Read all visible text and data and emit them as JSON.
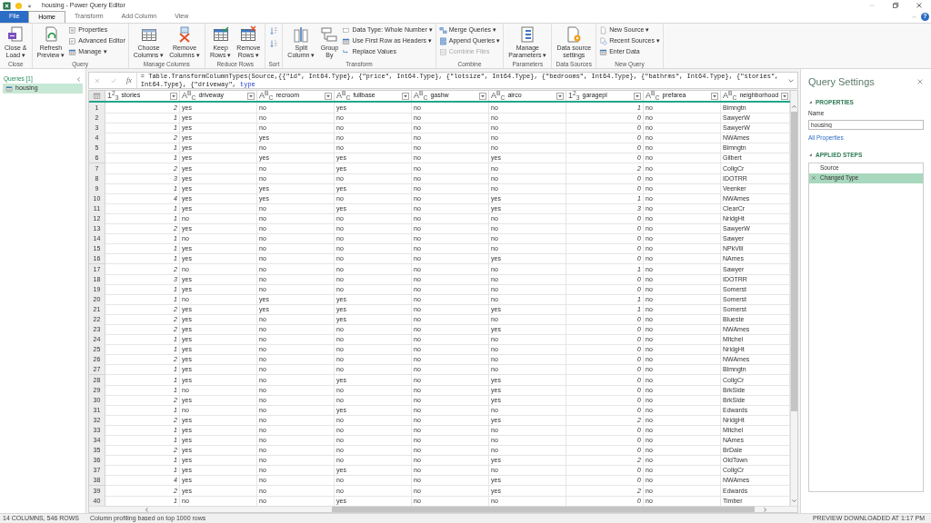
{
  "window": {
    "title": "housing - Power Query Editor",
    "help_label": "?"
  },
  "ribbon_tabs": [
    {
      "label": "File",
      "kind": "file",
      "selected": false
    },
    {
      "label": "Home",
      "kind": "tab",
      "selected": true
    },
    {
      "label": "Transform",
      "kind": "tab",
      "selected": false
    },
    {
      "label": "Add Column",
      "kind": "tab",
      "selected": false
    },
    {
      "label": "View",
      "kind": "tab",
      "selected": false
    }
  ],
  "ribbon_groups": [
    {
      "label": "Close",
      "items": [
        {
          "kind": "large",
          "lines": [
            "Close &",
            "Load ▾"
          ],
          "disabled": false
        }
      ]
    },
    {
      "label": "Query",
      "items": [
        {
          "kind": "large",
          "lines": [
            "Refresh",
            "Preview ▾"
          ],
          "disabled": false
        },
        {
          "kind": "stack",
          "buttons": [
            {
              "label": "Properties",
              "disabled": false
            },
            {
              "label": "Advanced Editor",
              "disabled": false
            },
            {
              "label": "Manage ▾",
              "disabled": false
            }
          ]
        }
      ]
    },
    {
      "label": "Manage Columns",
      "items": [
        {
          "kind": "large",
          "lines": [
            "Choose",
            "Columns ▾"
          ],
          "disabled": false
        },
        {
          "kind": "large",
          "lines": [
            "Remove",
            "Columns ▾"
          ],
          "disabled": false
        }
      ]
    },
    {
      "label": "Reduce Rows",
      "items": [
        {
          "kind": "large",
          "lines": [
            "Keep",
            "Rows ▾"
          ],
          "disabled": false
        },
        {
          "kind": "large",
          "lines": [
            "Remove",
            "Rows ▾"
          ],
          "disabled": false
        }
      ]
    },
    {
      "label": "Sort",
      "items": [
        {
          "kind": "icon_stack",
          "buttons": [
            {
              "disabled": false
            },
            {
              "disabled": false
            }
          ]
        }
      ]
    },
    {
      "label": "Transform",
      "items": [
        {
          "kind": "large",
          "lines": [
            "Split",
            "Column ▾"
          ],
          "disabled": false
        },
        {
          "kind": "large",
          "lines": [
            "Group",
            "By"
          ],
          "disabled": false
        },
        {
          "kind": "stack",
          "buttons": [
            {
              "label": "Data Type: Whole Number ▾",
              "disabled": false
            },
            {
              "label": "Use First Row as Headers ▾",
              "disabled": false
            },
            {
              "label": "Replace Values",
              "disabled": false
            }
          ]
        }
      ]
    },
    {
      "label": "Combine",
      "items": [
        {
          "kind": "stack",
          "buttons": [
            {
              "label": "Merge Queries ▾",
              "disabled": false
            },
            {
              "label": "Append Queries ▾",
              "disabled": false
            },
            {
              "label": "Combine Files",
              "disabled": true
            }
          ]
        }
      ]
    },
    {
      "label": "Parameters",
      "items": [
        {
          "kind": "large",
          "lines": [
            "Manage",
            "Parameters ▾"
          ],
          "disabled": false
        }
      ]
    },
    {
      "label": "Data Sources",
      "items": [
        {
          "kind": "large",
          "lines": [
            "Data source",
            "settings"
          ],
          "disabled": false
        }
      ]
    },
    {
      "label": "New Query",
      "items": [
        {
          "kind": "stack",
          "buttons": [
            {
              "label": "New Source ▾",
              "disabled": false
            },
            {
              "label": "Recent Sources ▾",
              "disabled": false
            },
            {
              "label": "Enter Data",
              "disabled": false
            }
          ]
        }
      ]
    }
  ],
  "queries_pane": {
    "header": "Queries [1]",
    "items": [
      {
        "label": "housing",
        "selected": true
      }
    ]
  },
  "formula_bar": {
    "fx_label": "fx",
    "parts": [
      {
        "kind": "plain",
        "text": "= Table.TransformColumnTypes(Source,{{\"id\", Int64.Type}, {\"price\", Int64.Type}, {\"lotsize\", Int64.Type}, {\"bedrooms\", Int64.Type}, {\"bathrms\", Int64.Type}, {\"stories\", Int64.Type}, {\"driveway\", "
      },
      {
        "kind": "keyword",
        "text": "type"
      }
    ]
  },
  "table": {
    "columns": [
      {
        "name": "stories",
        "kind": "number",
        "type_label": "1$^{2}$$_{3}$"
      },
      {
        "name": "driveway",
        "kind": "text",
        "type_label": "A$^{B}$$_{C}$"
      },
      {
        "name": "recroom",
        "kind": "text",
        "type_label": "A$^{B}$$_{C}$"
      },
      {
        "name": "fullbase",
        "kind": "text",
        "type_label": "A$^{B}$$_{C}$"
      },
      {
        "name": "gashw",
        "kind": "text",
        "type_label": "A$^{B}$$_{C}$"
      },
      {
        "name": "airco",
        "kind": "text",
        "type_label": "A$^{B}$$_{C}$"
      },
      {
        "name": "garagepl",
        "kind": "number",
        "type_label": "1$^{2}$$_{3}$"
      },
      {
        "name": "prefarea",
        "kind": "text",
        "type_label": "A$^{B}$$_{C}$"
      },
      {
        "name": "neighborhood",
        "kind": "text",
        "type_label": "A$^{B}$$_{C}$"
      }
    ],
    "rows": [
      {
        "number": "1",
        "cells": [
          "2",
          "yes",
          "no",
          "yes",
          "no",
          "no",
          "1",
          "no",
          "Blmngtn"
        ]
      },
      {
        "number": "2",
        "cells": [
          "1",
          "yes",
          "no",
          "no",
          "no",
          "no",
          "0",
          "no",
          "SawyerW"
        ]
      },
      {
        "number": "3",
        "cells": [
          "1",
          "yes",
          "no",
          "no",
          "no",
          "no",
          "0",
          "no",
          "SawyerW"
        ]
      },
      {
        "number": "4",
        "cells": [
          "2",
          "yes",
          "yes",
          "no",
          "no",
          "no",
          "0",
          "no",
          "NWAmes"
        ]
      },
      {
        "number": "5",
        "cells": [
          "1",
          "yes",
          "no",
          "no",
          "no",
          "no",
          "0",
          "no",
          "Blmngtn"
        ]
      },
      {
        "number": "6",
        "cells": [
          "1",
          "yes",
          "yes",
          "yes",
          "no",
          "yes",
          "0",
          "no",
          "Gilbert"
        ]
      },
      {
        "number": "7",
        "cells": [
          "2",
          "yes",
          "no",
          "yes",
          "no",
          "no",
          "2",
          "no",
          "CollgCr"
        ]
      },
      {
        "number": "8",
        "cells": [
          "3",
          "yes",
          "no",
          "no",
          "no",
          "no",
          "0",
          "no",
          "IDOTRR"
        ]
      },
      {
        "number": "9",
        "cells": [
          "1",
          "yes",
          "yes",
          "yes",
          "no",
          "no",
          "0",
          "no",
          "Veenker"
        ]
      },
      {
        "number": "10",
        "cells": [
          "4",
          "yes",
          "yes",
          "no",
          "no",
          "yes",
          "1",
          "no",
          "NWAmes"
        ]
      },
      {
        "number": "11",
        "cells": [
          "1",
          "yes",
          "no",
          "yes",
          "no",
          "yes",
          "3",
          "no",
          "ClearCr"
        ]
      },
      {
        "number": "12",
        "cells": [
          "1",
          "no",
          "no",
          "no",
          "no",
          "no",
          "0",
          "no",
          "NridgHt"
        ]
      },
      {
        "number": "13",
        "cells": [
          "2",
          "yes",
          "no",
          "no",
          "no",
          "no",
          "0",
          "no",
          "SawyerW"
        ]
      },
      {
        "number": "14",
        "cells": [
          "1",
          "no",
          "no",
          "no",
          "no",
          "no",
          "0",
          "no",
          "Sawyer"
        ]
      },
      {
        "number": "15",
        "cells": [
          "1",
          "yes",
          "no",
          "no",
          "no",
          "no",
          "0",
          "no",
          "NPkVill"
        ]
      },
      {
        "number": "16",
        "cells": [
          "1",
          "yes",
          "no",
          "no",
          "no",
          "yes",
          "0",
          "no",
          "NAmes"
        ]
      },
      {
        "number": "17",
        "cells": [
          "2",
          "no",
          "no",
          "no",
          "no",
          "no",
          "1",
          "no",
          "Sawyer"
        ]
      },
      {
        "number": "18",
        "cells": [
          "3",
          "yes",
          "no",
          "no",
          "no",
          "no",
          "0",
          "no",
          "IDOTRR"
        ]
      },
      {
        "number": "19",
        "cells": [
          "1",
          "yes",
          "no",
          "no",
          "no",
          "no",
          "0",
          "no",
          "Somerst"
        ]
      },
      {
        "number": "20",
        "cells": [
          "1",
          "no",
          "yes",
          "yes",
          "no",
          "no",
          "1",
          "no",
          "Somerst"
        ]
      },
      {
        "number": "21",
        "cells": [
          "2",
          "yes",
          "yes",
          "yes",
          "no",
          "yes",
          "1",
          "no",
          "Somerst"
        ]
      },
      {
        "number": "22",
        "cells": [
          "2",
          "yes",
          "no",
          "yes",
          "no",
          "no",
          "0",
          "no",
          "Blueste"
        ]
      },
      {
        "number": "23",
        "cells": [
          "2",
          "yes",
          "no",
          "no",
          "no",
          "yes",
          "0",
          "no",
          "NWAmes"
        ]
      },
      {
        "number": "24",
        "cells": [
          "1",
          "yes",
          "no",
          "no",
          "no",
          "no",
          "0",
          "no",
          "Mitchel"
        ]
      },
      {
        "number": "25",
        "cells": [
          "1",
          "yes",
          "no",
          "no",
          "no",
          "no",
          "0",
          "no",
          "NridgHt"
        ]
      },
      {
        "number": "26",
        "cells": [
          "2",
          "yes",
          "no",
          "no",
          "no",
          "no",
          "0",
          "no",
          "NWAmes"
        ]
      },
      {
        "number": "27",
        "cells": [
          "1",
          "yes",
          "no",
          "no",
          "no",
          "no",
          "0",
          "no",
          "Blmngtn"
        ]
      },
      {
        "number": "28",
        "cells": [
          "1",
          "yes",
          "no",
          "yes",
          "no",
          "yes",
          "0",
          "no",
          "CollgCr"
        ]
      },
      {
        "number": "29",
        "cells": [
          "1",
          "no",
          "no",
          "no",
          "no",
          "yes",
          "0",
          "no",
          "BrkSide"
        ]
      },
      {
        "number": "30",
        "cells": [
          "2",
          "yes",
          "no",
          "no",
          "no",
          "yes",
          "0",
          "no",
          "BrkSide"
        ]
      },
      {
        "number": "31",
        "cells": [
          "1",
          "no",
          "no",
          "yes",
          "no",
          "no",
          "0",
          "no",
          "Edwards"
        ]
      },
      {
        "number": "32",
        "cells": [
          "2",
          "yes",
          "no",
          "no",
          "no",
          "yes",
          "2",
          "no",
          "NridgHt"
        ]
      },
      {
        "number": "33",
        "cells": [
          "1",
          "yes",
          "no",
          "no",
          "no",
          "no",
          "0",
          "no",
          "Mitchel"
        ]
      },
      {
        "number": "34",
        "cells": [
          "1",
          "yes",
          "no",
          "no",
          "no",
          "no",
          "0",
          "no",
          "NAmes"
        ]
      },
      {
        "number": "35",
        "cells": [
          "2",
          "yes",
          "no",
          "no",
          "no",
          "no",
          "0",
          "no",
          "BrDale"
        ]
      },
      {
        "number": "36",
        "cells": [
          "1",
          "yes",
          "no",
          "no",
          "no",
          "yes",
          "2",
          "no",
          "OldTown"
        ]
      },
      {
        "number": "37",
        "cells": [
          "1",
          "yes",
          "no",
          "yes",
          "no",
          "no",
          "0",
          "no",
          "CollgCr"
        ]
      },
      {
        "number": "38",
        "cells": [
          "4",
          "yes",
          "no",
          "no",
          "no",
          "yes",
          "0",
          "no",
          "NWAmes"
        ]
      },
      {
        "number": "39",
        "cells": [
          "2",
          "yes",
          "no",
          "no",
          "no",
          "yes",
          "2",
          "no",
          "Edwards"
        ]
      },
      {
        "number": "40",
        "cells": [
          "1",
          "no",
          "no",
          "yes",
          "no",
          "no",
          "0",
          "no",
          "Timber"
        ]
      }
    ]
  },
  "query_settings": {
    "title": "Query Settings",
    "properties": {
      "heading": "PROPERTIES",
      "expanded": true,
      "name_label": "Name",
      "name_value": "housing",
      "link": "All Properties"
    },
    "applied_steps": {
      "heading": "APPLIED STEPS",
      "expanded": true,
      "steps": [
        {
          "label": "Source",
          "selected": false
        },
        {
          "label": "Changed Type",
          "selected": true
        }
      ]
    }
  },
  "status_bar": {
    "left": [
      "14 COLUMNS, 546 ROWS",
      "Column profiling based on top 1000 rows"
    ],
    "right": "PREVIEW DOWNLOADED AT 1:17 PM"
  }
}
